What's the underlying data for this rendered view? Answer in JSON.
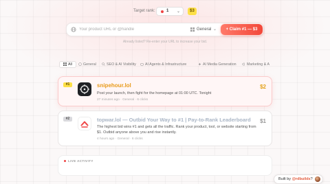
{
  "header": {
    "target_rank_label": "Target rank:",
    "rank_value": "1",
    "price_badge": "$3"
  },
  "search": {
    "placeholder": "Your product URL or @handle",
    "category": "General",
    "claim_label": "+ Claim #1 — $3",
    "helper": "Already listed? Re-enter your URL to increase your bid."
  },
  "tabs": [
    {
      "label": "All",
      "icon": "grid-icon"
    },
    {
      "label": "General",
      "icon": "globe-icon"
    },
    {
      "label": "SEO & AI Visibility",
      "icon": "search-icon"
    },
    {
      "label": "AI Agents & Infrastructure",
      "icon": "bot-icon"
    },
    {
      "label": "AI Media Generation",
      "icon": "sparkle-icon"
    },
    {
      "label": "Marketing & A",
      "icon": "megaphone-icon"
    }
  ],
  "listings": [
    {
      "rank": "#1",
      "title": "snipehour.lol",
      "description": "Post your launch, then fight for the homepage at 01:00 UTC. Tonight",
      "meta": "27 minutes ago · General · 6 clicks",
      "price": "$2",
      "logo_icon": "crosshair-logo"
    },
    {
      "rank": "#2",
      "title": "topwar.lol — Outbid Your Way to #1 | Pay-to-Rank Leaderboard",
      "description": "The highest bid wins #1 and gets all the traffic. Rank your product, tool, or website starting from $1. Outbid anyone above you and rise instantly.",
      "meta": "4 hours ago · General · 6 clicks",
      "price": "$1",
      "logo_icon": "chevron-up-logo"
    }
  ],
  "live": {
    "label": "LIVE ACTIVITY"
  },
  "builder": {
    "prefix": "Built by ",
    "handle": "@rdbuilds",
    "suffix": "?"
  },
  "colors": {
    "accent": "#f2483a",
    "gold": "#e89a1a",
    "badge_yellow": "#fde047"
  }
}
